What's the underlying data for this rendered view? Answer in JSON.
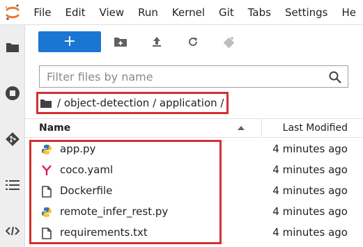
{
  "menu": {
    "items": [
      "File",
      "Edit",
      "View",
      "Run",
      "Kernel",
      "Git",
      "Tabs",
      "Settings",
      "He"
    ]
  },
  "activity_bar": {
    "icons": [
      "folder-icon",
      "stop-circle-icon",
      "git-icon",
      "list-icon",
      "code-icon"
    ]
  },
  "toolbar": {
    "new_label": "+",
    "icons": [
      "new-folder-icon",
      "upload-icon",
      "refresh-icon",
      "git-clone-icon"
    ]
  },
  "filter": {
    "placeholder": "Filter files by name"
  },
  "breadcrumb": {
    "path_text": "/ object-detection / application /"
  },
  "listing": {
    "name_header": "Name",
    "modified_header": "Last Modified",
    "files": [
      {
        "name": "app.py",
        "modified": "4 minutes ago",
        "icon": "python-icon"
      },
      {
        "name": "coco.yaml",
        "modified": "4 minutes ago",
        "icon": "yaml-icon"
      },
      {
        "name": "Dockerfile",
        "modified": "4 minutes ago",
        "icon": "file-icon"
      },
      {
        "name": "remote_infer_rest.py",
        "modified": "4 minutes ago",
        "icon": "python-icon"
      },
      {
        "name": "requirements.txt",
        "modified": "4 minutes ago",
        "icon": "file-icon"
      }
    ]
  },
  "colors": {
    "accent": "#1976d2",
    "highlight": "#d32f2f",
    "logo": "#f37726",
    "yaml": "#d81b60"
  }
}
